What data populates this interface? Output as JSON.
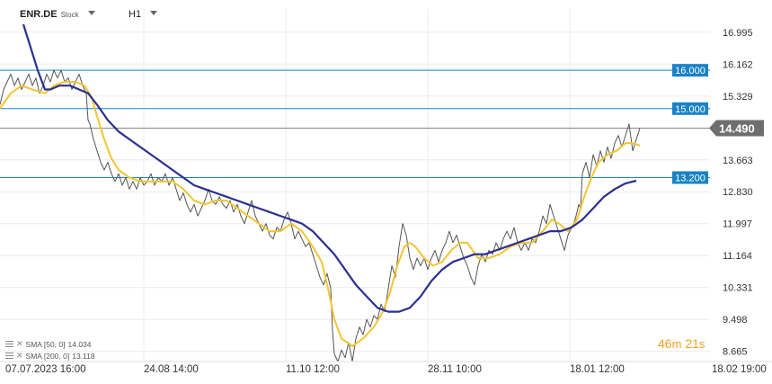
{
  "header": {
    "symbol": "ENR.DE",
    "type": "Stock",
    "timeframe": "H1"
  },
  "legend": [
    {
      "label": "SMA [50, 0]",
      "value": "14.034"
    },
    {
      "label": "SMA [200, 0]",
      "value": "13.118"
    }
  ],
  "countdown": {
    "minutes": "46",
    "m_unit": "m",
    "seconds": "21",
    "s_unit": "s"
  },
  "colors": {
    "price": "#555555",
    "sma50": "#f2c531",
    "sma200": "#2b2f8f",
    "level_line": "#1a82c4",
    "level_tag": "#1a82c4",
    "current_line": "#888888",
    "current_tag": "#6e6e6e",
    "grid": "#ececec"
  },
  "chart_data": {
    "type": "line",
    "ylim": [
      8.4,
      17.6
    ],
    "y_ticks": [
      "16.995",
      "16.162",
      "15.329",
      "14.496",
      "13.663",
      "12.830",
      "11.997",
      "11.164",
      "10.331",
      "9.498",
      "8.665"
    ],
    "x_ticks": [
      "07.07.2023  16:00",
      "24.08  14:00",
      "11.10  12:00",
      "28.11  10:00",
      "18.01  12:00",
      "18.02  19:00"
    ],
    "levels": [
      "16.000",
      "15.000",
      "13.200"
    ],
    "current_price": "14.490",
    "series": [
      {
        "name": "Price",
        "values": [
          [
            0,
            15.1
          ],
          [
            4,
            15.5
          ],
          [
            8,
            15.7
          ],
          [
            12,
            15.9
          ],
          [
            16,
            15.6
          ],
          [
            20,
            15.8
          ],
          [
            24,
            15.5
          ],
          [
            28,
            15.7
          ],
          [
            32,
            15.9
          ],
          [
            36,
            15.6
          ],
          [
            40,
            15.8
          ],
          [
            44,
            15.4
          ],
          [
            48,
            15.6
          ],
          [
            52,
            15.9
          ],
          [
            56,
            15.7
          ],
          [
            60,
            16.0
          ],
          [
            64,
            15.8
          ],
          [
            68,
            16.0
          ],
          [
            72,
            15.7
          ],
          [
            76,
            15.8
          ],
          [
            80,
            15.5
          ],
          [
            84,
            15.7
          ],
          [
            88,
            15.9
          ],
          [
            92,
            15.6
          ],
          [
            96,
            15.4
          ],
          [
            98,
            14.7
          ],
          [
            100,
            14.6
          ],
          [
            104,
            14.2
          ],
          [
            108,
            13.9
          ],
          [
            112,
            13.6
          ],
          [
            116,
            13.4
          ],
          [
            120,
            13.6
          ],
          [
            124,
            13.3
          ],
          [
            128,
            13.1
          ],
          [
            132,
            13.3
          ],
          [
            136,
            13.0
          ],
          [
            140,
            13.2
          ],
          [
            144,
            12.9
          ],
          [
            148,
            13.1
          ],
          [
            152,
            12.9
          ],
          [
            156,
            13.2
          ],
          [
            160,
            13.0
          ],
          [
            164,
            13.1
          ],
          [
            168,
            13.3
          ],
          [
            172,
            13.0
          ],
          [
            176,
            13.2
          ],
          [
            180,
            13.1
          ],
          [
            184,
            13.3
          ],
          [
            188,
            13.0
          ],
          [
            192,
            13.2
          ],
          [
            196,
            12.9
          ],
          [
            200,
            12.6
          ],
          [
            204,
            12.8
          ],
          [
            208,
            12.5
          ],
          [
            212,
            12.3
          ],
          [
            216,
            12.5
          ],
          [
            220,
            12.2
          ],
          [
            224,
            12.4
          ],
          [
            228,
            12.6
          ],
          [
            232,
            12.9
          ],
          [
            236,
            12.6
          ],
          [
            240,
            12.5
          ],
          [
            244,
            12.7
          ],
          [
            248,
            12.5
          ],
          [
            252,
            12.4
          ],
          [
            256,
            12.6
          ],
          [
            260,
            12.3
          ],
          [
            264,
            12.5
          ],
          [
            268,
            12.2
          ],
          [
            272,
            12.0
          ],
          [
            276,
            12.3
          ],
          [
            280,
            12.6
          ],
          [
            284,
            12.2
          ],
          [
            288,
            12.0
          ],
          [
            292,
            11.8
          ],
          [
            296,
            12.0
          ],
          [
            300,
            11.7
          ],
          [
            304,
            11.6
          ],
          [
            308,
            11.9
          ],
          [
            312,
            11.8
          ],
          [
            316,
            12.1
          ],
          [
            320,
            12.3
          ],
          [
            324,
            12.0
          ],
          [
            328,
            11.6
          ],
          [
            332,
            11.8
          ],
          [
            336,
            11.6
          ],
          [
            340,
            11.4
          ],
          [
            344,
            11.5
          ],
          [
            348,
            11.2
          ],
          [
            352,
            10.9
          ],
          [
            356,
            10.6
          ],
          [
            360,
            10.4
          ],
          [
            364,
            10.7
          ],
          [
            368,
            10.3
          ],
          [
            370,
            9.2
          ],
          [
            372,
            8.6
          ],
          [
            376,
            8.4
          ],
          [
            380,
            8.7
          ],
          [
            384,
            8.5
          ],
          [
            388,
            8.9
          ],
          [
            392,
            8.4
          ],
          [
            396,
            9.0
          ],
          [
            400,
            9.3
          ],
          [
            404,
            9.1
          ],
          [
            408,
            9.5
          ],
          [
            412,
            9.3
          ],
          [
            416,
            9.6
          ],
          [
            420,
            9.5
          ],
          [
            424,
            9.9
          ],
          [
            428,
            9.7
          ],
          [
            432,
            10.3
          ],
          [
            436,
            10.9
          ],
          [
            440,
            10.6
          ],
          [
            444,
            11.4
          ],
          [
            448,
            12.0
          ],
          [
            452,
            11.7
          ],
          [
            456,
            11.1
          ],
          [
            460,
            10.8
          ],
          [
            464,
            11.1
          ],
          [
            468,
            10.9
          ],
          [
            472,
            11.1
          ],
          [
            476,
            10.8
          ],
          [
            480,
            11.1
          ],
          [
            484,
            11.3
          ],
          [
            488,
            11.0
          ],
          [
            492,
            11.3
          ],
          [
            496,
            11.5
          ],
          [
            500,
            11.8
          ],
          [
            504,
            11.5
          ],
          [
            508,
            11.7
          ],
          [
            512,
            11.4
          ],
          [
            516,
            11.1
          ],
          [
            520,
            10.9
          ],
          [
            524,
            10.6
          ],
          [
            528,
            10.4
          ],
          [
            532,
            10.9
          ],
          [
            536,
            11.2
          ],
          [
            540,
            11.0
          ],
          [
            544,
            11.3
          ],
          [
            548,
            11.2
          ],
          [
            552,
            11.5
          ],
          [
            556,
            11.3
          ],
          [
            560,
            11.6
          ],
          [
            564,
            11.8
          ],
          [
            568,
            11.6
          ],
          [
            572,
            11.9
          ],
          [
            576,
            11.5
          ],
          [
            580,
            11.3
          ],
          [
            584,
            11.5
          ],
          [
            588,
            11.3
          ],
          [
            592,
            11.6
          ],
          [
            596,
            11.5
          ],
          [
            600,
            11.8
          ],
          [
            604,
            12.2
          ],
          [
            608,
            12.0
          ],
          [
            612,
            12.5
          ],
          [
            616,
            12.2
          ],
          [
            620,
            11.9
          ],
          [
            624,
            11.6
          ],
          [
            628,
            11.3
          ],
          [
            632,
            11.7
          ],
          [
            636,
            11.9
          ],
          [
            640,
            12.1
          ],
          [
            644,
            12.5
          ],
          [
            646,
            12.4
          ],
          [
            648,
            13.3
          ],
          [
            652,
            13.6
          ],
          [
            656,
            13.2
          ],
          [
            660,
            13.8
          ],
          [
            664,
            13.5
          ],
          [
            668,
            13.9
          ],
          [
            672,
            13.6
          ],
          [
            676,
            14.0
          ],
          [
            680,
            13.7
          ],
          [
            684,
            14.1
          ],
          [
            688,
            14.3
          ],
          [
            692,
            14.0
          ],
          [
            696,
            14.3
          ],
          [
            700,
            14.6
          ],
          [
            704,
            13.9
          ],
          [
            708,
            14.2
          ],
          [
            712,
            14.49
          ]
        ]
      },
      {
        "name": "SMA 50",
        "values": [
          [
            0,
            15.0
          ],
          [
            12,
            15.4
          ],
          [
            24,
            15.6
          ],
          [
            36,
            15.5
          ],
          [
            50,
            15.4
          ],
          [
            60,
            15.6
          ],
          [
            72,
            15.7
          ],
          [
            84,
            15.7
          ],
          [
            94,
            15.6
          ],
          [
            102,
            15.3
          ],
          [
            108,
            14.8
          ],
          [
            116,
            14.2
          ],
          [
            124,
            13.7
          ],
          [
            132,
            13.4
          ],
          [
            144,
            13.2
          ],
          [
            156,
            13.1
          ],
          [
            168,
            13.1
          ],
          [
            180,
            13.1
          ],
          [
            192,
            13.1
          ],
          [
            204,
            12.9
          ],
          [
            216,
            12.6
          ],
          [
            228,
            12.5
          ],
          [
            240,
            12.6
          ],
          [
            252,
            12.6
          ],
          [
            264,
            12.4
          ],
          [
            276,
            12.2
          ],
          [
            288,
            12.0
          ],
          [
            300,
            11.8
          ],
          [
            312,
            11.8
          ],
          [
            324,
            12.0
          ],
          [
            336,
            11.8
          ],
          [
            348,
            11.4
          ],
          [
            358,
            11.0
          ],
          [
            366,
            10.2
          ],
          [
            372,
            9.5
          ],
          [
            380,
            9.0
          ],
          [
            392,
            8.8
          ],
          [
            404,
            9.0
          ],
          [
            416,
            9.3
          ],
          [
            426,
            9.7
          ],
          [
            434,
            10.2
          ],
          [
            442,
            10.9
          ],
          [
            450,
            11.4
          ],
          [
            456,
            11.5
          ],
          [
            462,
            11.4
          ],
          [
            472,
            11.1
          ],
          [
            482,
            10.9
          ],
          [
            492,
            11.0
          ],
          [
            502,
            11.3
          ],
          [
            512,
            11.5
          ],
          [
            520,
            11.5
          ],
          [
            532,
            11.1
          ],
          [
            544,
            11.1
          ],
          [
            556,
            11.2
          ],
          [
            568,
            11.4
          ],
          [
            580,
            11.5
          ],
          [
            592,
            11.5
          ],
          [
            604,
            11.8
          ],
          [
            614,
            12.1
          ],
          [
            622,
            12.0
          ],
          [
            632,
            11.8
          ],
          [
            642,
            12.1
          ],
          [
            650,
            12.7
          ],
          [
            658,
            13.2
          ],
          [
            666,
            13.6
          ],
          [
            676,
            13.8
          ],
          [
            686,
            13.9
          ],
          [
            696,
            14.1
          ],
          [
            704,
            14.1
          ],
          [
            712,
            14.034
          ]
        ]
      },
      {
        "name": "SMA 200",
        "values": [
          [
            26,
            17.2
          ],
          [
            34,
            16.6
          ],
          [
            42,
            16.0
          ],
          [
            50,
            15.5
          ],
          [
            56,
            15.5
          ],
          [
            66,
            15.6
          ],
          [
            78,
            15.6
          ],
          [
            88,
            15.5
          ],
          [
            98,
            15.4
          ],
          [
            108,
            15.1
          ],
          [
            120,
            14.7
          ],
          [
            132,
            14.4
          ],
          [
            144,
            14.2
          ],
          [
            156,
            14.0
          ],
          [
            168,
            13.8
          ],
          [
            180,
            13.6
          ],
          [
            192,
            13.4
          ],
          [
            204,
            13.2
          ],
          [
            216,
            13.0
          ],
          [
            228,
            12.9
          ],
          [
            240,
            12.8
          ],
          [
            252,
            12.7
          ],
          [
            264,
            12.6
          ],
          [
            276,
            12.5
          ],
          [
            288,
            12.4
          ],
          [
            300,
            12.3
          ],
          [
            312,
            12.2
          ],
          [
            324,
            12.1
          ],
          [
            336,
            12.0
          ],
          [
            348,
            11.8
          ],
          [
            360,
            11.5
          ],
          [
            372,
            11.2
          ],
          [
            384,
            10.8
          ],
          [
            396,
            10.4
          ],
          [
            408,
            10.1
          ],
          [
            420,
            9.8
          ],
          [
            432,
            9.7
          ],
          [
            444,
            9.7
          ],
          [
            456,
            9.8
          ],
          [
            468,
            10.1
          ],
          [
            480,
            10.5
          ],
          [
            492,
            10.8
          ],
          [
            504,
            11.0
          ],
          [
            516,
            11.1
          ],
          [
            528,
            11.2
          ],
          [
            540,
            11.2
          ],
          [
            552,
            11.3
          ],
          [
            564,
            11.4
          ],
          [
            576,
            11.5
          ],
          [
            588,
            11.6
          ],
          [
            600,
            11.7
          ],
          [
            612,
            11.8
          ],
          [
            624,
            11.8
          ],
          [
            636,
            11.9
          ],
          [
            648,
            12.1
          ],
          [
            660,
            12.4
          ],
          [
            672,
            12.7
          ],
          [
            684,
            12.9
          ],
          [
            696,
            13.05
          ],
          [
            708,
            13.118
          ]
        ]
      }
    ]
  }
}
